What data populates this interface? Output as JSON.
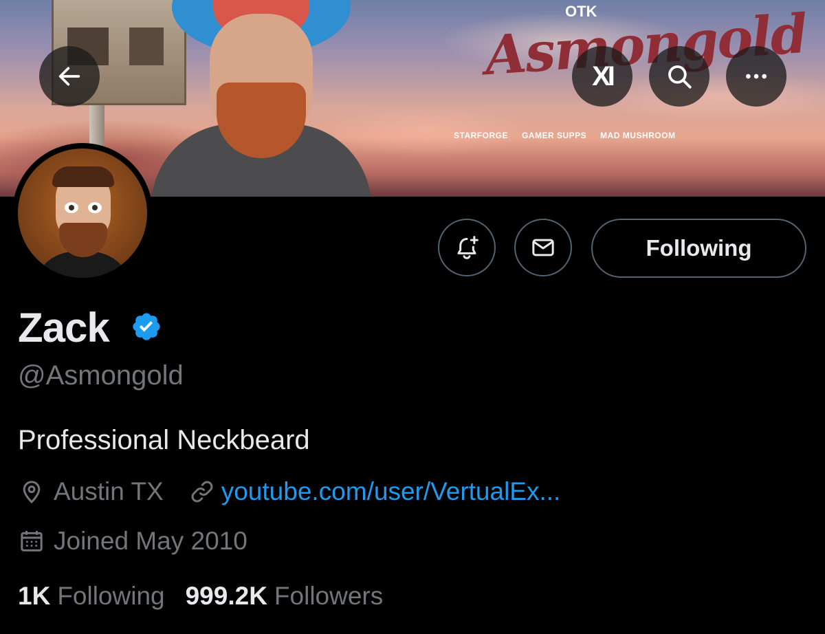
{
  "banner": {
    "brand_text": "Asmongold",
    "org_badge": "OTK",
    "sponsors": [
      "STARFORGE",
      "GAMER SUPPS",
      "MAD MUSHROOM"
    ]
  },
  "header_buttons": {
    "back": "back-arrow-icon",
    "grok": "xai-grok-icon",
    "search": "search-icon",
    "more": "more-horizontal-icon",
    "grok_glyph": "XI"
  },
  "actions": {
    "notify_icon": "bell-plus-icon",
    "message_icon": "mail-icon",
    "following_label": "Following"
  },
  "profile": {
    "display_name": "Zack",
    "verified": true,
    "handle": "@Asmongold",
    "bio": "Professional Neckbeard",
    "location": "Austin TX",
    "website": "youtube.com/user/VertualEx...",
    "joined": "Joined May 2010"
  },
  "stats": {
    "following_count": "1K",
    "following_label": "Following",
    "followers_count": "999.2K",
    "followers_label": "Followers"
  },
  "colors": {
    "background": "#000000",
    "text_primary": "#e7e9ea",
    "text_secondary": "#71767b",
    "link": "#1d9bf0",
    "verified": "#1d9bf0",
    "button_border": "#536471"
  }
}
